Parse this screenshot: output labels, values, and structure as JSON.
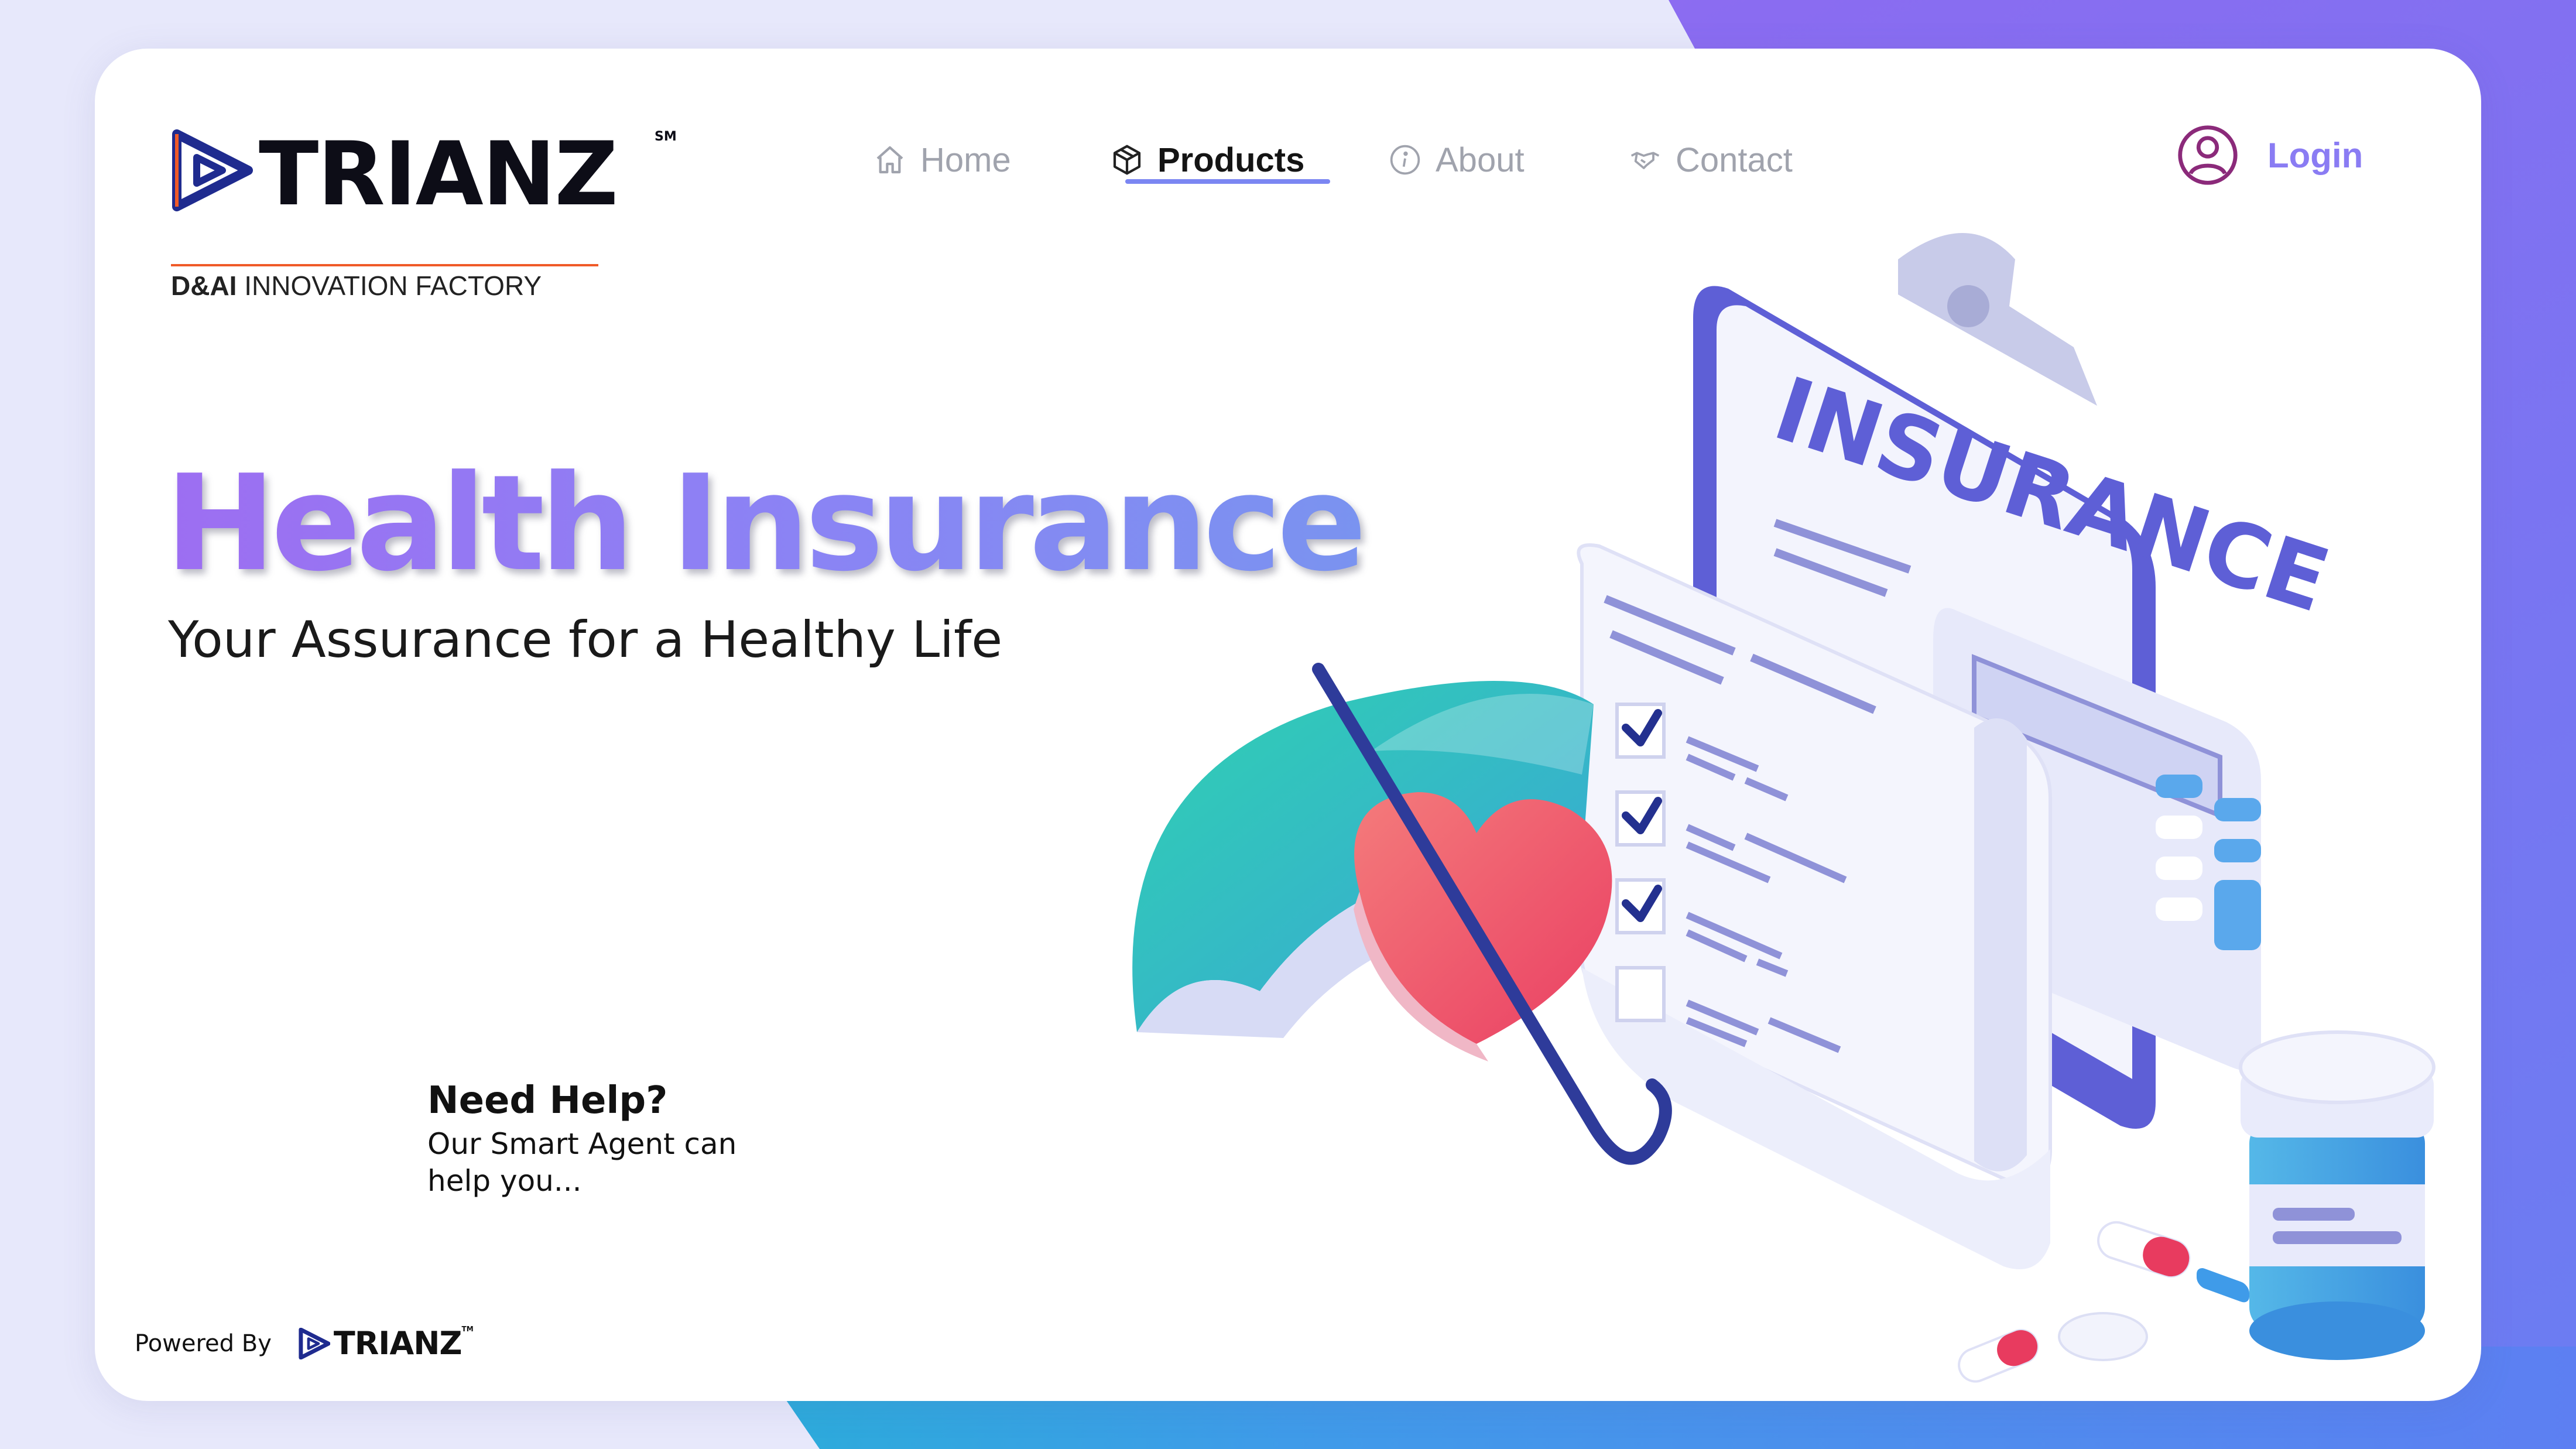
{
  "brand": {
    "name": "TRIANZ",
    "sm": "SM",
    "tagline_bold": "D&AI",
    "tagline_rest": " INNOVATION FACTORY",
    "accent": "#f05a28",
    "mark_color": "#1f2b8f"
  },
  "nav": {
    "items": [
      {
        "label": "Home",
        "icon": "home-icon"
      },
      {
        "label": "Products",
        "icon": "box-icon",
        "active": true
      },
      {
        "label": "About",
        "icon": "info-icon"
      },
      {
        "label": "Contact",
        "icon": "handshake-icon"
      }
    ],
    "login_label": "Login"
  },
  "hero": {
    "title": "Health Insurance",
    "subtitle": "Your Assurance for a Healthy Life"
  },
  "help": {
    "title": "Need Help?",
    "body": "Our Smart Agent can help you..."
  },
  "illustration": {
    "clipboard_text": "INSURANCE"
  },
  "footer": {
    "powered_label": "Powered By",
    "brand": "TRIANZ",
    "tm": "TM"
  },
  "colors": {
    "title_gradient_start": "#9d6ef2",
    "title_gradient_end": "#7a93f0",
    "nav_active_underline": "#7b86f2",
    "login_text": "#8a7cf3",
    "login_icon": "#8b2a7a"
  }
}
